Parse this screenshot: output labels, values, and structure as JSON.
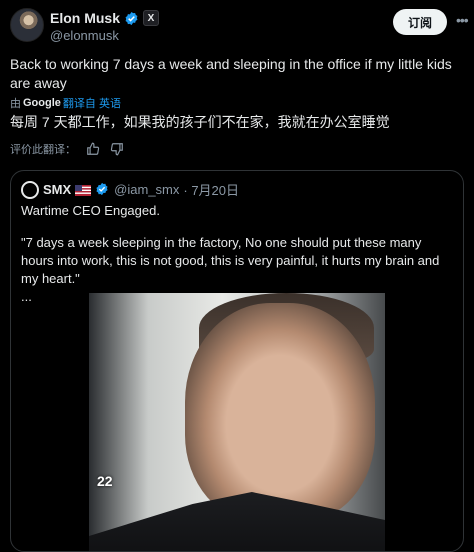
{
  "author": {
    "name": "Elon Musk",
    "handle": "@elonmusk",
    "badge_letter": "X"
  },
  "subscribe_label": "订阅",
  "tweet": {
    "text": "Back to working 7 days a week and sleeping in the office if my little kids are away",
    "translated_prefix": "由",
    "translated_by": "Google",
    "translated_link": "翻译自 英语",
    "translation": "每周 7 天都工作，如果我的孩子们不在家，我就在办公室睡觉",
    "rate_label": "评价此翻译："
  },
  "quote": {
    "name": "SMX",
    "handle": "@iam_smx",
    "date": "· 7月20日",
    "line1": "Wartime CEO Engaged.",
    "line2": "\"7 days a week sleeping in the factory, No one should put these many hours into work, this is not good, this is very painful, it hurts my brain and my heart.\"",
    "line3": "...",
    "video_timer": "22"
  },
  "colors": {
    "background": "#000000",
    "text": "#e7e9ea",
    "muted": "#8b98a5",
    "accent": "#1d9bf0",
    "verified": "#1d9bf0"
  }
}
